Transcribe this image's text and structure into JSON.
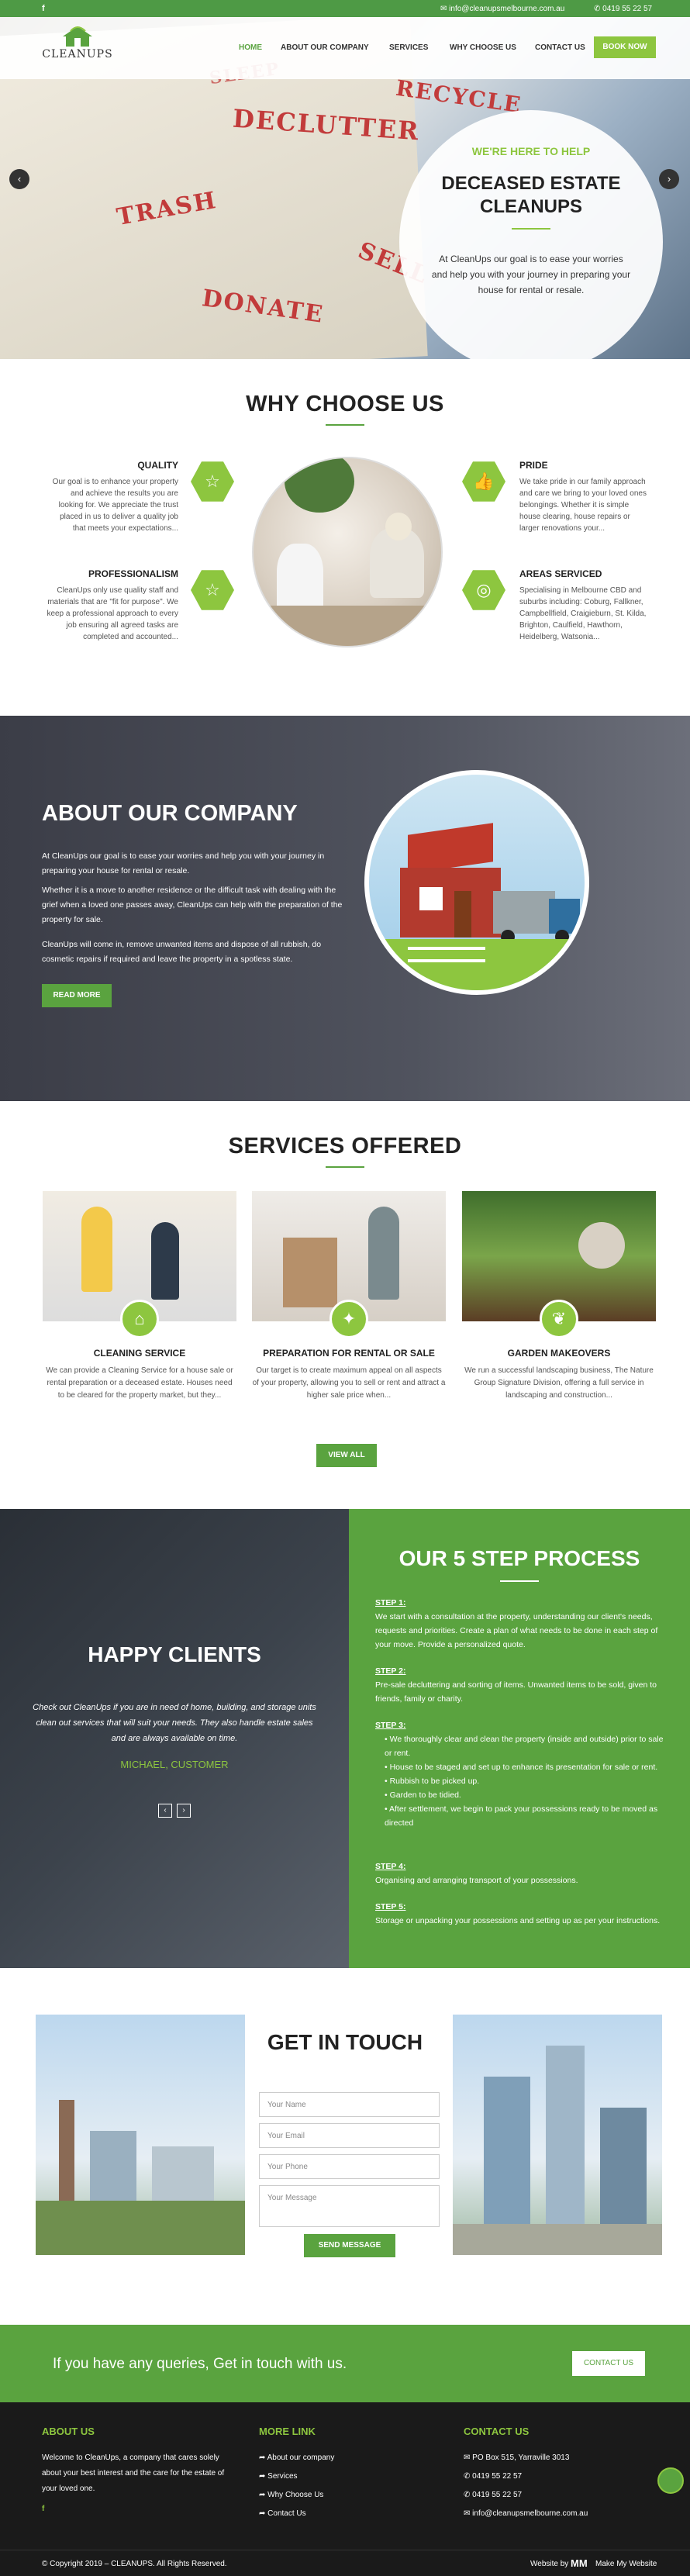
{
  "topbar": {
    "facebook": "f",
    "email": "info@cleanupsmelbourne.com.au",
    "phone": "0419 55 22 57"
  },
  "brand": {
    "logo_text": "CLEANUPS",
    "accent": "#8dc63f",
    "green": "#5aa33f"
  },
  "nav": {
    "items": [
      "HOME",
      "ABOUT OUR COMPANY",
      "SERVICES",
      "WHY CHOOSE US",
      "CONTACT US"
    ],
    "book": "BOOK NOW"
  },
  "hero": {
    "kicker": "WE'RE HERE TO HELP",
    "title": "DECEASED ESTATE CLEANUPS",
    "desc": "At CleanUps our goal is to ease your worries and help you with your journey in preparing your house for rental or resale.",
    "paper_words": [
      "SLEEP",
      "RECYCLE",
      "DECLUTTER",
      "TRASH",
      "SELL",
      "DONATE"
    ],
    "prev": "‹",
    "next": "›"
  },
  "why": {
    "title": "WHY CHOOSE US",
    "features": [
      {
        "name": "QUALITY",
        "text": "Our goal is to enhance your property and achieve the results you are looking for. We appreciate the trust placed in us to deliver a quality job that meets your expectations..."
      },
      {
        "name": "PROFESSIONALISM",
        "text": "CleanUps only use quality staff and materials that are \"fit for purpose\". We keep a professional approach to every job ensuring all agreed tasks are completed and accounted..."
      },
      {
        "name": "PRIDE",
        "text": "We take pride in our family approach and care we bring to your loved ones belongings. Whether it is simple house clearing, house repairs or larger renovations your..."
      },
      {
        "name": "AREAS SERVICED",
        "text": "Specialising in Melbourne CBD and suburbs including: Coburg, Fallkner, Campbellfield, Craigieburn, St. Kilda, Brighton, Caulfield, Hawthorn, Heidelberg, Watsonia..."
      }
    ]
  },
  "about": {
    "title": "ABOUT OUR COMPANY",
    "p1_brand": "CleanUps",
    "p1": "At CleanUps our goal is to ease your worries and help you with your journey in preparing your house for rental or resale.",
    "p2": "Whether it is a move to another residence or the difficult task with dealing with the grief when a loved one passes away, CleanUps can help with the preparation of the property for sale.",
    "p3": "CleanUps will come in, remove unwanted items and dispose of all rubbish, do cosmetic repairs if required and leave the property in a spotless state.",
    "read_more": "READ MORE"
  },
  "services": {
    "title": "SERVICES OFFERED",
    "items": [
      {
        "name": "CLEANING SERVICE",
        "text": "We can provide a Cleaning Service for a house sale or rental preparation or a deceased estate. Houses need to be cleared for the property market, but they..."
      },
      {
        "name": "PREPARATION FOR RENTAL OR SALE",
        "text": "Our target is to create maximum appeal on all aspects of your property, allowing you to sell or rent and attract a higher sale price when..."
      },
      {
        "name": "GARDEN MAKEOVERS",
        "text": "We run a successful landscaping business, The Nature Group Signature Division, offering a full service in landscaping and construction..."
      }
    ],
    "view_all": "VIEW ALL"
  },
  "testimonial": {
    "title": "HAPPY CLIENTS",
    "quote": "Check out CleanUps if you are in need of home, building, and storage units clean out services that will suit your needs. They also handle estate sales and are always available on time.",
    "name": "MICHAEL, CUSTOMER",
    "prev": "‹",
    "next": "›"
  },
  "process": {
    "title": "OUR 5 STEP PROCESS",
    "steps": [
      {
        "label": "STEP 1:",
        "text": "We start with a consultation at the property, understanding our client's needs, requests and priorities. Create a plan of what needs to be done in each step of your move. Provide a personalized quote."
      },
      {
        "label": "STEP 2:",
        "text": "Pre-sale decluttering and sorting of items. Unwanted items to be sold, given to friends, family or charity."
      },
      {
        "label": "STEP 3:",
        "bullets": [
          "We thoroughly clear and clean the property (inside and outside) prior to sale or rent.",
          "House to be staged and set up to enhance its presentation for sale or rent.",
          "Rubbish to be picked up.",
          "Garden to be tidied.",
          "After settlement, we begin to pack your possessions ready to be moved as directed"
        ]
      },
      {
        "label": "STEP 4:",
        "text": "Organising and arranging transport of your possessions."
      },
      {
        "label": "STEP 5:",
        "text": "Storage or unpacking your possessions and setting up as per your instructions."
      }
    ]
  },
  "contact": {
    "title": "GET IN TOUCH",
    "name_ph": "Your Name",
    "email_ph": "Your Email",
    "phone_ph": "Your Phone",
    "message_ph": "Your Message",
    "send": "SEND MESSAGE"
  },
  "cta": {
    "text": "If you have any queries, Get in touch with us.",
    "button": "CONTACT US"
  },
  "footer": {
    "about_title": "ABOUT US",
    "about_text": "Welcome to CleanUps, a company that cares solely about your best interest and the care for the estate of your loved one.",
    "links_title": "MORE LINK",
    "links": [
      "About our company",
      "Services",
      "Why Choose Us",
      "Contact Us"
    ],
    "contact_title": "CONTACT US",
    "contact": [
      "PO Box 515, Yarraville 3013",
      "0419 55 22 57",
      "0419 55 22 57",
      "info@cleanupsmelbourne.com.au"
    ],
    "copyright": "© Copyright 2019 – CLEANUPS. All Rights Reserved.",
    "credit_pre": "Website by",
    "credit": "Make My Website"
  }
}
